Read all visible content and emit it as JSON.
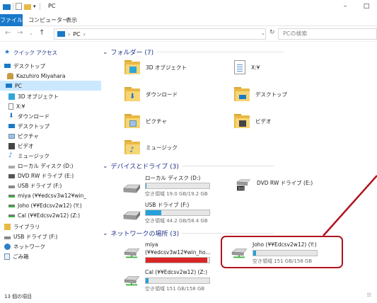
{
  "window": {
    "title": "PC",
    "buttons": {
      "minimize": "–",
      "maximize": "□"
    }
  },
  "ribbon": {
    "tabs": [
      "ファイル",
      "コンピューター",
      "表示"
    ]
  },
  "address": {
    "breadcrumb": [
      "PC"
    ],
    "search_placeholder": "PCの検索"
  },
  "sidebar": {
    "items": [
      {
        "label": "クイック アクセス",
        "icon": "star-icon"
      },
      {
        "label": "デスクトップ",
        "icon": "desktop-icon"
      },
      {
        "label": "Kazuhiro Miyahara",
        "icon": "user-icon"
      },
      {
        "label": "PC",
        "icon": "pc-icon",
        "selected": true
      },
      {
        "label": "3D オブジェクト",
        "icon": "3d-icon"
      },
      {
        "label": "X:¥",
        "icon": "doc-icon"
      },
      {
        "label": "ダウンロード",
        "icon": "download-icon"
      },
      {
        "label": "デスクトップ",
        "icon": "desktop-icon"
      },
      {
        "label": "ピクチャ",
        "icon": "picture-icon"
      },
      {
        "label": "ビデオ",
        "icon": "video-icon"
      },
      {
        "label": "ミュージック",
        "icon": "music-icon"
      },
      {
        "label": "ローカル ディスク (D:)",
        "icon": "drive-icon"
      },
      {
        "label": "DVD RW ドライブ (E:)",
        "icon": "dvd-icon"
      },
      {
        "label": "USB ドライブ (F:)",
        "icon": "usb-icon"
      },
      {
        "label": "miya (¥¥edcsv3w12¥win_",
        "icon": "netdrive-icon"
      },
      {
        "label": "Joho (¥¥Edcsv2w12) (Y:)",
        "icon": "netdrive-icon"
      },
      {
        "label": "Cal (¥¥Edcsv2w12) (Z:)",
        "icon": "netdrive-icon"
      },
      {
        "label": "ライブラリ",
        "icon": "library-icon"
      },
      {
        "label": "USB ドライブ (F:)",
        "icon": "usb-icon"
      },
      {
        "label": "ネットワーク",
        "icon": "network-icon"
      },
      {
        "label": "ごみ箱",
        "icon": "trash-icon"
      }
    ]
  },
  "groups": {
    "folders": "フォルダー (7)",
    "devices": "デバイスとドライブ (3)",
    "network": "ネットワークの場所 (3)"
  },
  "folders": [
    {
      "label": "3D オブジェクト"
    },
    {
      "label": "X:¥"
    },
    {
      "label": "ダウンロード"
    },
    {
      "label": "デスクトップ"
    },
    {
      "label": "ピクチャ"
    },
    {
      "label": "ビデオ"
    },
    {
      "label": "ミュージック"
    }
  ],
  "devices": [
    {
      "name": "ローカル ディスク (D:)",
      "free": "空き領域 19.0 GB/19.2 GB",
      "used_fraction": 0.01
    },
    {
      "name": "DVD RW ドライブ (E:)"
    },
    {
      "name": "USB ドライブ (F:)",
      "free": "空き領域 44.2 GB/58.4 GB",
      "used_fraction": 0.24
    }
  ],
  "network": [
    {
      "name": "miya",
      "name2": "(¥¥edcsv3w12¥win_ho...",
      "used_fraction": 0.97
    },
    {
      "name": "Joho (¥¥Edcsv2w12) (Y:)",
      "free": "空き領域 151 GB/158 GB",
      "used_fraction": 0.04
    },
    {
      "name": "Cal (¥¥Edcsv2w12) (Z:)",
      "free": "空き領域 151 GB/158 GB",
      "used_fraction": 0.04
    }
  ],
  "status": {
    "count": "13 個の項目"
  },
  "colors": {
    "accent": "#1979ca",
    "bar": "#26a0da",
    "bar_full": "#da2626",
    "highlight": "#b0141e"
  }
}
